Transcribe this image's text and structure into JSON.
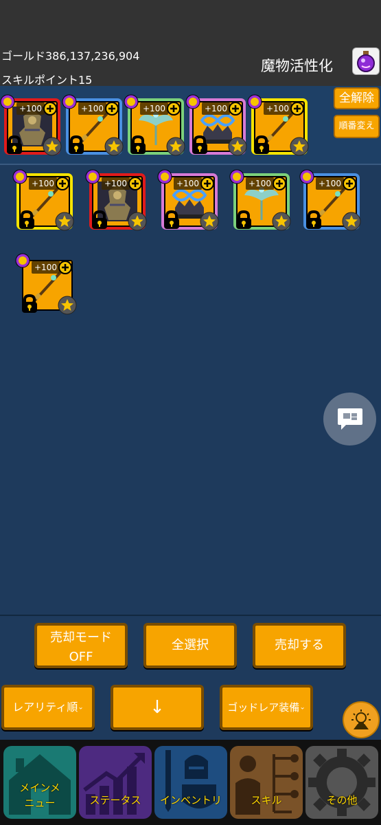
{
  "header": {
    "gold_text": "ゴールド386,137,236,904",
    "skill_points_text": "スキルポイント15",
    "activation_label": "魔物活性化"
  },
  "equip_controls": {
    "release_all": "全解除",
    "reorder": "順番変え"
  },
  "badge_text": "+100",
  "equipped": [
    {
      "item": "god-armor",
      "frame": "red"
    },
    {
      "item": "spear",
      "frame": "blue"
    },
    {
      "item": "winged-staff",
      "frame": "green"
    },
    {
      "item": "infinity-crown",
      "frame": "pink"
    },
    {
      "item": "spear",
      "frame": "yellow"
    }
  ],
  "inventory": [
    {
      "item": "spear",
      "frame": "yellow"
    },
    {
      "item": "god-armor",
      "frame": "red"
    },
    {
      "item": "infinity-crown",
      "frame": "pink"
    },
    {
      "item": "winged-staff",
      "frame": "green"
    },
    {
      "item": "spear",
      "frame": "blue"
    },
    {
      "item": "spear",
      "frame": "none"
    }
  ],
  "actions": {
    "sell_mode_line1": "売却モード",
    "sell_mode_line2": "OFF",
    "select_all": "全選択",
    "sell": "売却する",
    "sort_rarity": "レアリティ順",
    "sort_direction": "↓",
    "filter": "ゴッドレア装備"
  },
  "nav": {
    "main_menu_line1": "メインメ",
    "main_menu_line2": "ニュー",
    "status": "ステータス",
    "inventory": "インベントリ",
    "skill": "スキル",
    "other": "その他"
  },
  "colors": {
    "accent_orange": "#f7a400",
    "background_blue": "#1e3a5c",
    "frame_red": "#e21b1b",
    "frame_blue": "#4a90e2",
    "frame_green": "#7bd17b",
    "frame_pink": "#d77ad6",
    "frame_yellow": "#f5e400",
    "frame_none": "#1e3a5c"
  }
}
